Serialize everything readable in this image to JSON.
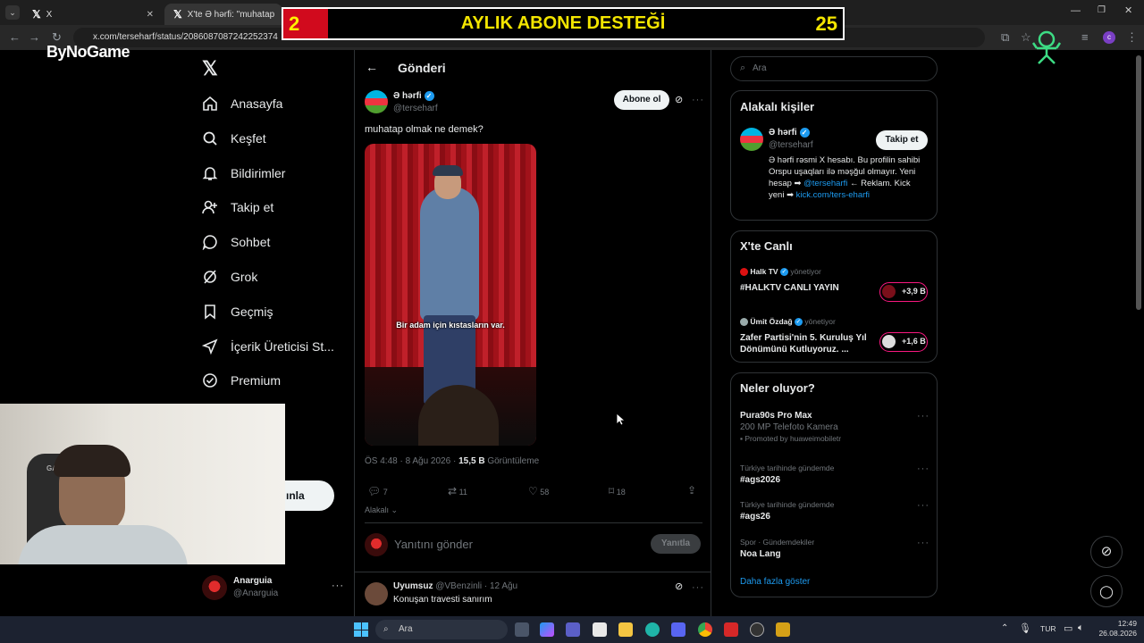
{
  "browser": {
    "tabs": [
      {
        "title": "X"
      },
      {
        "title": "X'te Ə hərfi: \"muhatap olma"
      }
    ],
    "url": "x.com/terseharf/status/2086087087242252374"
  },
  "banner": {
    "left_number": "2",
    "title": "AYLIK ABONE DESTEĞİ",
    "right_number": "25"
  },
  "logo": "ByNoGame",
  "nav": {
    "items": [
      {
        "label": "Anasayfa",
        "icon": "home-icon"
      },
      {
        "label": "Keşfet",
        "icon": "search-icon"
      },
      {
        "label": "Bildirimler",
        "icon": "bell-icon"
      },
      {
        "label": "Takip et",
        "icon": "person-add-icon"
      },
      {
        "label": "Sohbet",
        "icon": "chat-icon"
      },
      {
        "label": "Grok",
        "icon": "grok-icon"
      },
      {
        "label": "Geçmiş",
        "icon": "bookmark-icon"
      },
      {
        "label": "İçerik Üreticisi St...",
        "icon": "rocket-icon"
      },
      {
        "label": "Premium",
        "icon": "premium-icon"
      }
    ],
    "post_button_fragment": "ınla",
    "profile": {
      "name": "Anarguia",
      "handle": "@Anarguia"
    }
  },
  "post": {
    "header_title": "Gönderi",
    "author_name": "Ə hərfi",
    "author_handle": "@terseharf",
    "follow_label": "Abone ol",
    "text": "muhatap olmak ne demek?",
    "video_caption": "Bir adam için kıstasların var.",
    "timestamp": "ÖS 4:48 · 8 Ağu 2026 ·",
    "views_count": "15,5 B",
    "views_label": "Görüntüleme",
    "stats": {
      "replies": "7",
      "reposts": "11",
      "likes": "58",
      "bookmarks": "18"
    },
    "relevance_label": "Alakalı",
    "reply_placeholder": "Yanıtını gönder",
    "reply_button": "Yanıtla"
  },
  "reply": {
    "name": "Uyumsuz",
    "handle": "@VBenzinli",
    "date": "· 12 Ağu",
    "text": "Konuşan travesti sanırım"
  },
  "sidebar": {
    "search_placeholder": "Ara",
    "related": {
      "title": "Alakalı kişiler",
      "name": "Ə hərfi",
      "handle": "@terseharf",
      "follow_label": "Takip et",
      "bio_part1": "Ə hərfi rəsmi X hesabı. Bu profilin sahibi Orspu uşaqları ilə məşğul olmayır. Yeni hesap ➡",
      "bio_link1": "@terseharfi",
      "bio_part2": "← Reklam. Kick yeni ➡",
      "bio_link2": "kick.com/ters-eharfi"
    },
    "live": {
      "title": "X'te Canlı",
      "items": [
        {
          "host": "Halk TV",
          "suffix": "yönetiyor",
          "title": "#HALKTV CANLI YAYIN",
          "count": "+3,9 B"
        },
        {
          "host": "Ümit Özdağ",
          "suffix": "yönetiyor",
          "title": "Zafer Partisi'nin 5. Kuruluş Yıl Dönümünü Kutluyoruz. ...",
          "count": "+1,6 B"
        }
      ]
    },
    "trends": {
      "title": "Neler oluyor?",
      "items": [
        {
          "context": "",
          "title": "Pura90s Pro Max",
          "sub": "200 MP Telefoto Kamera",
          "promo": "Promoted by huaweimobiletr"
        },
        {
          "context": "Türkiye tarihinde gündemde",
          "title": "#ags2026",
          "sub": "",
          "promo": ""
        },
        {
          "context": "Türkiye tarihinde gündemde",
          "title": "#ags26",
          "sub": "",
          "promo": ""
        },
        {
          "context": "Spor · Gündemdekiler",
          "title": "Noa Lang",
          "sub": "",
          "promo": ""
        }
      ],
      "show_more": "Daha fazla göster"
    }
  },
  "taskbar": {
    "search_label": "Ara",
    "language": "TUR",
    "time": "12:49",
    "date": "26.08.2026"
  },
  "colors": {
    "accent": "#1d9bf0",
    "banner_red": "#d10a1d",
    "banner_yellow": "#f3e500",
    "live_pink": "#f91880"
  }
}
